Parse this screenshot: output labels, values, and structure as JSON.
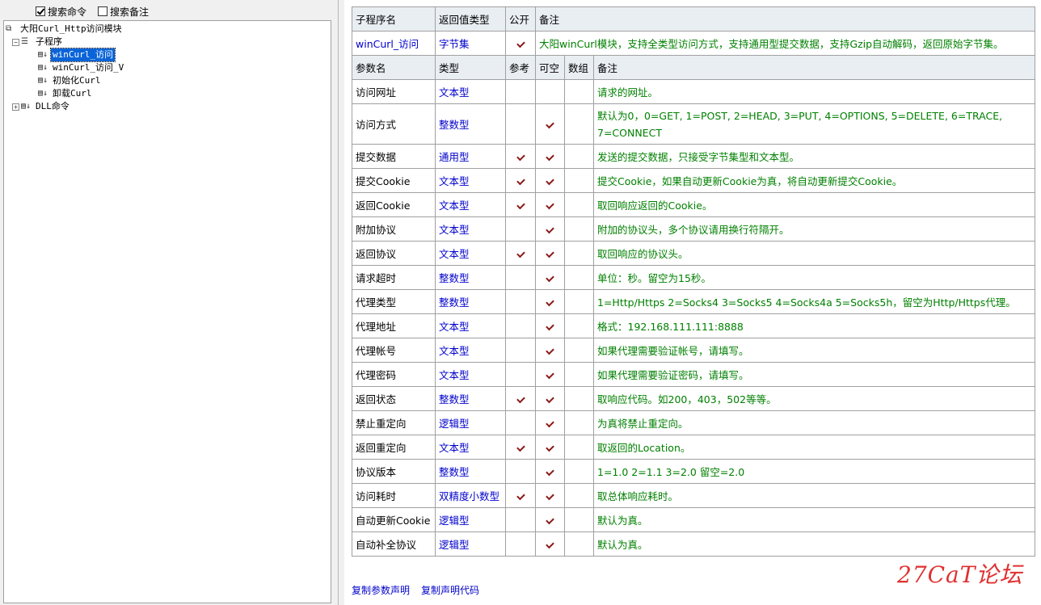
{
  "search": {
    "cmd_label": "搜索命令",
    "cmd_checked": true,
    "note_label": "搜索备注",
    "note_checked": false
  },
  "tree": {
    "root": "大阳Curl_Http访问模块",
    "subprogram_group": "子程序",
    "items": [
      "winCurl_访问",
      "winCurl_访问_V",
      "初始化Curl",
      "卸载Curl"
    ],
    "dll_group": "DLL命令"
  },
  "sub_header": {
    "col_name": "子程序名",
    "col_return": "返回值类型",
    "col_public": "公开",
    "col_note": "备注"
  },
  "sub_row": {
    "name": "winCurl_访问",
    "return_type": "字节集",
    "public": true,
    "note": "大阳winCurl模块，支持全类型访问方式，支持通用型提交数据，支持Gzip自动解码，返回原始字节集。"
  },
  "param_header": {
    "col_name": "参数名",
    "col_type": "类型",
    "col_ref": "参考",
    "col_optional": "可空",
    "col_array": "数组",
    "col_note": "备注"
  },
  "params": [
    {
      "name": "访问网址",
      "type": "文本型",
      "ref": false,
      "optional": false,
      "note": "请求的网址。"
    },
    {
      "name": "访问方式",
      "type": "整数型",
      "ref": false,
      "optional": true,
      "note": "默认为0，0=GET, 1=POST, 2=HEAD, 3=PUT, 4=OPTIONS, 5=DELETE, 6=TRACE, 7=CONNECT"
    },
    {
      "name": "提交数据",
      "type": "通用型",
      "ref": true,
      "optional": true,
      "note": "发送的提交数据，只接受字节集型和文本型。"
    },
    {
      "name": "提交Cookie",
      "type": "文本型",
      "ref": true,
      "optional": true,
      "note": "提交Cookie，如果自动更新Cookie为真，将自动更新提交Cookie。"
    },
    {
      "name": "返回Cookie",
      "type": "文本型",
      "ref": true,
      "optional": true,
      "note": "取回响应返回的Cookie。"
    },
    {
      "name": "附加协议",
      "type": "文本型",
      "ref": false,
      "optional": true,
      "note": "附加的协议头，多个协议请用换行符隔开。"
    },
    {
      "name": "返回协议",
      "type": "文本型",
      "ref": true,
      "optional": true,
      "note": "取回响应的协议头。"
    },
    {
      "name": "请求超时",
      "type": "整数型",
      "ref": false,
      "optional": true,
      "note": "单位：秒。留空为15秒。"
    },
    {
      "name": "代理类型",
      "type": "整数型",
      "ref": false,
      "optional": true,
      "note": "1=Http/Https 2=Socks4 3=Socks5 4=Socks4a 5=Socks5h，留空为Http/Https代理。"
    },
    {
      "name": "代理地址",
      "type": "文本型",
      "ref": false,
      "optional": true,
      "note": "格式：192.168.111.111:8888"
    },
    {
      "name": "代理帐号",
      "type": "文本型",
      "ref": false,
      "optional": true,
      "note": "如果代理需要验证帐号，请填写。"
    },
    {
      "name": "代理密码",
      "type": "文本型",
      "ref": false,
      "optional": true,
      "note": "如果代理需要验证密码，请填写。"
    },
    {
      "name": "返回状态",
      "type": "整数型",
      "ref": true,
      "optional": true,
      "note": "取响应代码。如200，403，502等等。"
    },
    {
      "name": "禁止重定向",
      "type": "逻辑型",
      "ref": false,
      "optional": true,
      "note": "为真将禁止重定向。"
    },
    {
      "name": "返回重定向",
      "type": "文本型",
      "ref": true,
      "optional": true,
      "note": "取返回的Location。"
    },
    {
      "name": "协议版本",
      "type": "整数型",
      "ref": false,
      "optional": true,
      "note": "1=1.0 2=1.1 3=2.0 留空=2.0"
    },
    {
      "name": "访问耗时",
      "type": "双精度小数型",
      "ref": true,
      "optional": true,
      "note": "取总体响应耗时。"
    },
    {
      "name": "自动更新Cookie",
      "type": "逻辑型",
      "ref": false,
      "optional": true,
      "note": "默认为真。"
    },
    {
      "name": "自动补全协议",
      "type": "逻辑型",
      "ref": false,
      "optional": true,
      "note": "默认为真。"
    }
  ],
  "links": {
    "copy_params": "复制参数声明",
    "copy_code": "复制声明代码"
  },
  "watermark": "27CaT论坛",
  "colors": {
    "selection": "#0a64d8",
    "type_text": "#0000cc",
    "note_text": "#008000",
    "check": "#8b1a1a",
    "header_bg": "#e9eef3"
  }
}
